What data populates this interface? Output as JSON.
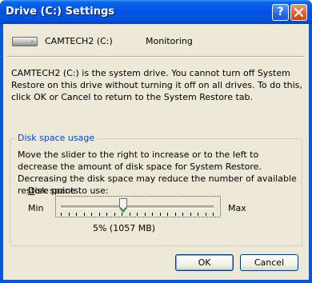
{
  "window": {
    "title": "Drive (C:) Settings"
  },
  "titlebar": {
    "help_label": "?",
    "close_label": "✕"
  },
  "drive": {
    "label": "CAMTECH2 (C:)",
    "status": "Monitoring"
  },
  "description": "CAMTECH2 (C:) is the system drive. You cannot turn off System Restore on this drive without turning it off on all drives. To do this, click OK or Cancel to return to the System Restore tab.",
  "disk_space": {
    "group_title": "Disk space usage",
    "instructions": "Move the slider to the right to increase or to the left to decrease the amount of disk space for System Restore. Decreasing the disk space may reduce the number of available restore points.",
    "slider_label_mnemonic": "D",
    "slider_label_rest": "isk space to use:",
    "min_label": "Min",
    "max_label": "Max",
    "value_text": "5% (1057 MB)",
    "slider_fraction": 0.41
  },
  "buttons": {
    "ok": "OK",
    "cancel": "Cancel"
  }
}
